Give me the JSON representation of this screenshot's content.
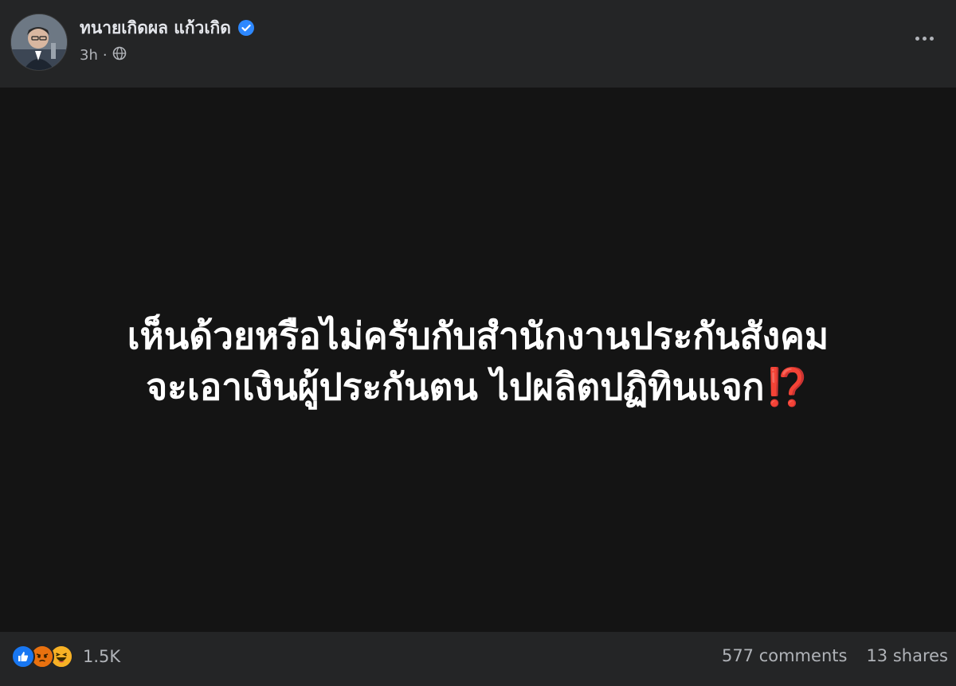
{
  "post": {
    "author_name": "ทนายเกิดผล แก้วเกิด",
    "time": "3h",
    "separator": "·",
    "visibility_icon": "globe-icon",
    "verified_icon": "verified-badge-icon",
    "more_icon": "more-options-icon"
  },
  "image_text": {
    "line1": "เห็นด้วยหรือไม่ครับกับสำนักงานประกันสังคม",
    "line2": "จะเอาเงินผู้ประกันตน ไปผลิตปฏิทินแจก",
    "line2_suffix": "⁉️"
  },
  "footer": {
    "reactions": [
      "like",
      "angry",
      "haha"
    ],
    "reaction_count": "1.5K",
    "comments": "577 comments",
    "shares": "13 shares"
  },
  "colors": {
    "background": "#242526",
    "image_bg": "#141414",
    "verified": "#2d88ff",
    "like": "#1877f2",
    "angry": "#e9710f",
    "haha": "#f7b125",
    "exclamation_question": "#e0242f"
  }
}
